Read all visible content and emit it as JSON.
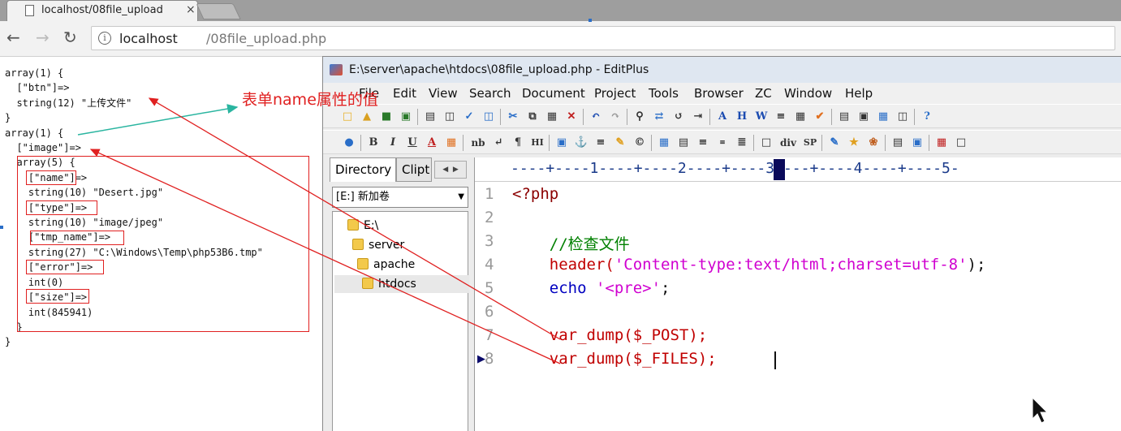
{
  "browser": {
    "tab_title": "localhost/08file_upload",
    "tab_close": "×",
    "url_host": "localhost",
    "url_path": "/08file_upload.php",
    "info_glyph": "i"
  },
  "dump": {
    "lines": [
      "array(1) {",
      "  [\"btn\"]=>",
      "  string(12) \"上传文件\"",
      "}",
      "array(1) {",
      "  [\"image\"]=>",
      "  array(5) {",
      "    [\"name\"]=>",
      "    string(10) \"Desert.jpg\"",
      "    [\"type\"]=>",
      "    string(10) \"image/jpeg\"",
      "    [\"tmp_name\"]=>",
      "    string(27) \"C:\\Windows\\Temp\\php53B6.tmp\"",
      "    [\"error\"]=>",
      "    int(0)",
      "    [\"size\"]=>",
      "    int(845941)",
      "  }",
      "}"
    ]
  },
  "annotation": {
    "text": "表单name属性的值"
  },
  "editplus": {
    "title": "E:\\server\\apache\\htdocs\\08file_upload.php - EditPlus",
    "menu": [
      "File",
      "Edit",
      "View",
      "Search",
      "Document",
      "Project",
      "Tools",
      "Browser",
      "ZC",
      "Window",
      "Help"
    ],
    "toolbar2_labels": [
      "B",
      "I",
      "U",
      "A",
      "nb",
      "¶",
      "HI",
      "div",
      "SP"
    ],
    "panel": {
      "tab_directory": "Directory",
      "tab_clip": "Clipt",
      "drive": "[E:] 新加卷",
      "tree": [
        "E:\\",
        "server",
        "apache",
        "htdocs"
      ]
    },
    "ruler": "----+----1----+----2----+----3----+----4----+----5-",
    "code": [
      {
        "n": "1",
        "text": "<?php"
      },
      {
        "n": "2",
        "text": ""
      },
      {
        "n": "3",
        "text": "    //检查文件"
      },
      {
        "n": "4",
        "fn": "    header(",
        "str": "'Content-type:text/html;charset=utf-8'",
        "tail": ");"
      },
      {
        "n": "5",
        "fn": "    echo ",
        "str": "'<pre>'",
        "tail": ";"
      },
      {
        "n": "6",
        "text": ""
      },
      {
        "n": "7",
        "text": "    var_dump($_POST);"
      },
      {
        "n": "8",
        "text": "    var_dump($_FILES);"
      }
    ]
  },
  "colors": {
    "annotation_red": "#e02020",
    "arrow_teal": "#2ab5a0",
    "keyword": "#8b0000",
    "comment": "#008000",
    "string": "#d000d0"
  }
}
